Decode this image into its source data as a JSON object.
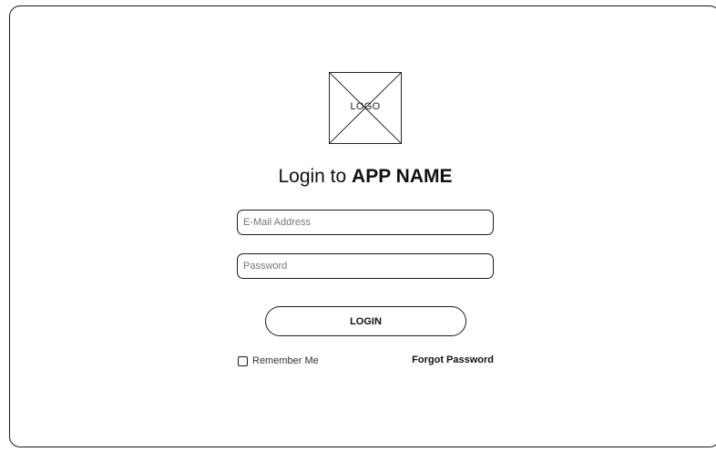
{
  "logo": {
    "label": "LOGO",
    "icon": "placeholder-image-icon"
  },
  "title": {
    "prefix": "Login to ",
    "app_name": "APP NAME"
  },
  "form": {
    "email_placeholder": "E-Mail Address",
    "email_value": "",
    "password_placeholder": "Password",
    "password_value": "",
    "login_label": "LOGIN",
    "remember_label": "Remember Me",
    "remember_checked": false,
    "forgot_label": "Forgot Password"
  },
  "colors": {
    "stroke": "#1a1a1a",
    "background": "#ffffff"
  }
}
